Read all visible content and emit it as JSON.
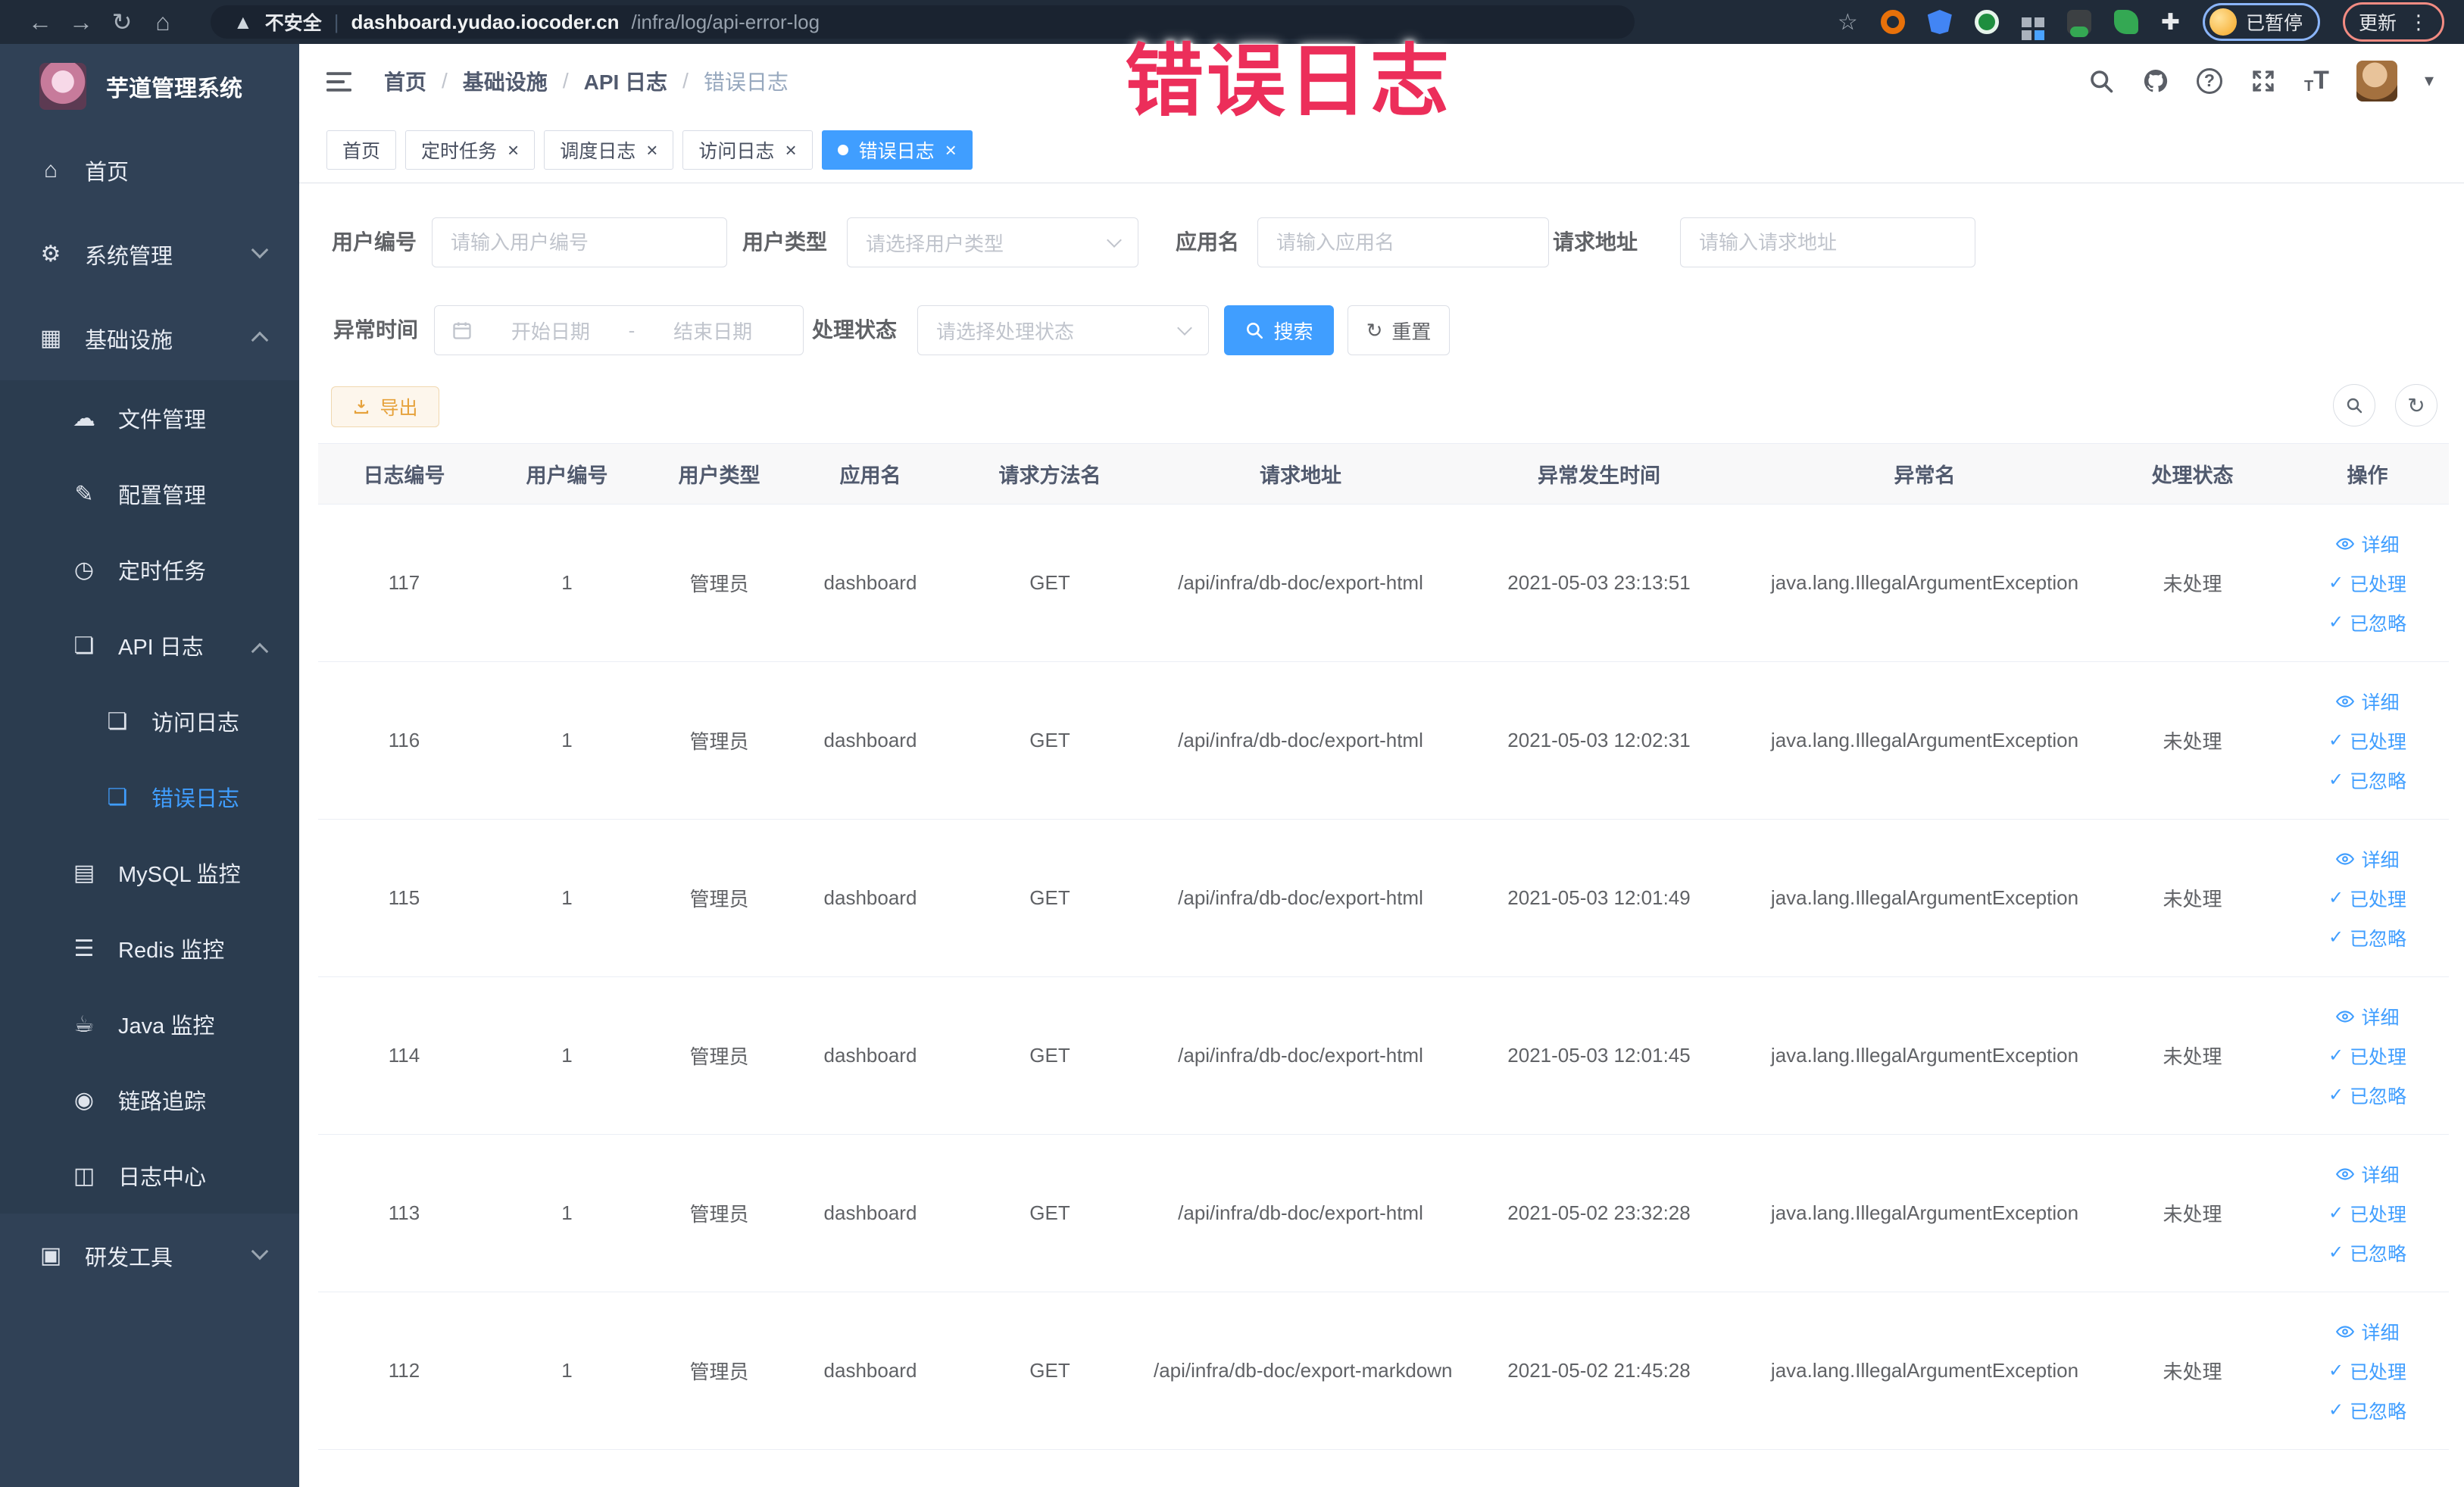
{
  "browser": {
    "security_label": "不安全",
    "url_host": "dashboard.yudao.iocoder.cn",
    "url_path": "/infra/log/api-error-log",
    "profile_label": "已暂停",
    "update_label": "更新"
  },
  "annotation": {
    "text": "错误日志"
  },
  "sidebar": {
    "title": "芋道管理系统",
    "items": [
      {
        "label": "首页",
        "icon": "home",
        "level": 0
      },
      {
        "label": "系统管理",
        "icon": "gear",
        "level": 0,
        "chevron": "down"
      },
      {
        "label": "基础设施",
        "icon": "monitor",
        "level": 0,
        "chevron": "up"
      },
      {
        "label": "文件管理",
        "icon": "cloud",
        "level": 1
      },
      {
        "label": "配置管理",
        "icon": "edit",
        "level": 1
      },
      {
        "label": "定时任务",
        "icon": "timer",
        "level": 1
      },
      {
        "label": "API 日志",
        "icon": "log",
        "level": 1,
        "chevron": "up"
      },
      {
        "label": "访问日志",
        "icon": "log",
        "level": 2
      },
      {
        "label": "错误日志",
        "icon": "log",
        "level": 2,
        "active": true
      },
      {
        "label": "MySQL 监控",
        "icon": "db",
        "level": 1
      },
      {
        "label": "Redis 监控",
        "icon": "layers",
        "level": 1
      },
      {
        "label": "Java 监控",
        "icon": "coffee",
        "level": 1
      },
      {
        "label": "链路追踪",
        "icon": "eye",
        "level": 1
      },
      {
        "label": "日志中心",
        "icon": "logcenter",
        "level": 1
      },
      {
        "label": "研发工具",
        "icon": "briefcase",
        "level": 0,
        "chevron": "down"
      }
    ]
  },
  "breadcrumb": [
    "首页",
    "基础设施",
    "API 日志",
    "错误日志"
  ],
  "tabs": [
    {
      "label": "首页",
      "closable": false,
      "active": false
    },
    {
      "label": "定时任务",
      "closable": true,
      "active": false
    },
    {
      "label": "调度日志",
      "closable": true,
      "active": false
    },
    {
      "label": "访问日志",
      "closable": true,
      "active": false
    },
    {
      "label": "错误日志",
      "closable": true,
      "active": true
    }
  ],
  "filters": {
    "user_id": {
      "label": "用户编号",
      "placeholder": "请输入用户编号"
    },
    "user_type": {
      "label": "用户类型",
      "placeholder": "请选择用户类型"
    },
    "app_name": {
      "label": "应用名",
      "placeholder": "请输入应用名"
    },
    "request_url": {
      "label": "请求地址",
      "placeholder": "请输入请求地址"
    },
    "exception_time": {
      "label": "异常时间",
      "start_placeholder": "开始日期",
      "separator": "-",
      "end_placeholder": "结束日期"
    },
    "process_status": {
      "label": "处理状态",
      "placeholder": "请选择处理状态"
    },
    "search_label": "搜索",
    "reset_label": "重置"
  },
  "toolbar": {
    "export_label": "导出"
  },
  "table": {
    "columns": [
      "日志编号",
      "用户编号",
      "用户类型",
      "应用名",
      "请求方法名",
      "请求地址",
      "异常发生时间",
      "异常名",
      "处理状态",
      "操作"
    ],
    "actions": [
      {
        "name": "detail",
        "label": "详细",
        "icon": "eye"
      },
      {
        "name": "mark-processed",
        "label": "已处理",
        "icon": "check"
      },
      {
        "name": "mark-ignored",
        "label": "已忽略",
        "icon": "check"
      }
    ],
    "rows": [
      {
        "id": "117",
        "user_id": "1",
        "user_type": "管理员",
        "app": "dashboard",
        "method": "GET",
        "url": "/api/infra/db-doc/export-html",
        "time": "2021-05-03 23:13:51",
        "exception": "java.lang.IllegalArgumentException",
        "status": "未处理"
      },
      {
        "id": "116",
        "user_id": "1",
        "user_type": "管理员",
        "app": "dashboard",
        "method": "GET",
        "url": "/api/infra/db-doc/export-html",
        "time": "2021-05-03 12:02:31",
        "exception": "java.lang.IllegalArgumentException",
        "status": "未处理"
      },
      {
        "id": "115",
        "user_id": "1",
        "user_type": "管理员",
        "app": "dashboard",
        "method": "GET",
        "url": "/api/infra/db-doc/export-html",
        "time": "2021-05-03 12:01:49",
        "exception": "java.lang.IllegalArgumentException",
        "status": "未处理"
      },
      {
        "id": "114",
        "user_id": "1",
        "user_type": "管理员",
        "app": "dashboard",
        "method": "GET",
        "url": "/api/infra/db-doc/export-html",
        "time": "2021-05-03 12:01:45",
        "exception": "java.lang.IllegalArgumentException",
        "status": "未处理"
      },
      {
        "id": "113",
        "user_id": "1",
        "user_type": "管理员",
        "app": "dashboard",
        "method": "GET",
        "url": "/api/infra/db-doc/export-html",
        "time": "2021-05-02 23:32:28",
        "exception": "java.lang.IllegalArgumentException",
        "status": "未处理"
      },
      {
        "id": "112",
        "user_id": "1",
        "user_type": "管理员",
        "app": "dashboard",
        "method": "GET",
        "url": "/api/infra/db-doc/export-markdown",
        "time": "2021-05-02 21:45:28",
        "exception": "java.lang.IllegalArgumentException",
        "status": "未处理"
      }
    ]
  }
}
